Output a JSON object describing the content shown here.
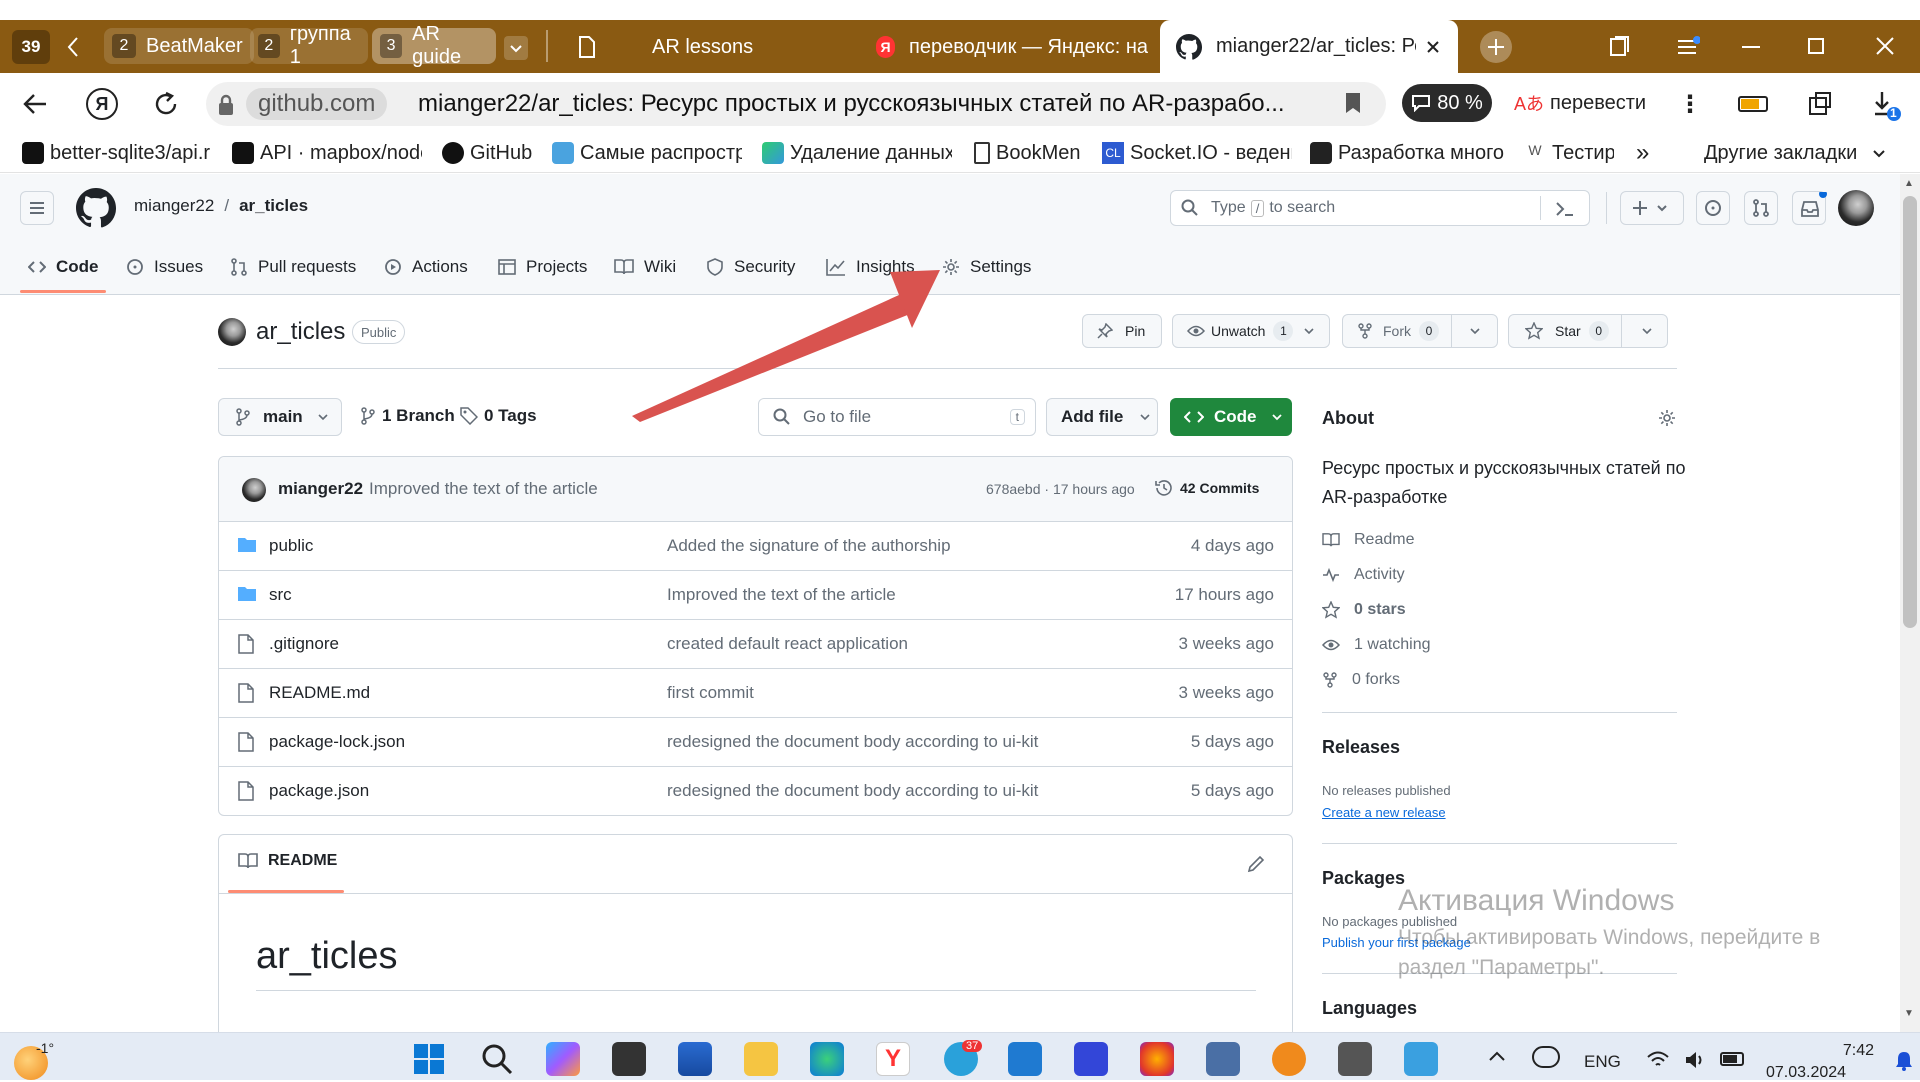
{
  "browser": {
    "tab_count": "39",
    "groups": [
      {
        "num": "2",
        "label": "BeatMaker"
      },
      {
        "num": "2",
        "label": "группа 1"
      },
      {
        "num": "3",
        "label": "AR guide"
      }
    ],
    "tabs": [
      {
        "label": "AR lessons"
      },
      {
        "label": "переводчик — Яндекс: на"
      },
      {
        "label": "mianger22/ar_ticles: Рес"
      }
    ],
    "address": {
      "domain": "github.com",
      "title": "mianger22/ar_ticles: Ресурс простых и русскоязычных статей по AR-разрабо...",
      "zoom": "80 %",
      "translate": "перевести",
      "downloads_badge": "1"
    },
    "bookmarks": [
      "better-sqlite3/api.r",
      "API · mapbox/node",
      "GitHub",
      "Самые распростр",
      "Удаление данных",
      "BookMen",
      "Socket.IO - ведени",
      "Разработка много",
      "Тестир"
    ],
    "bookmarks_more": "»",
    "other_bookmarks": "Другие закладки"
  },
  "github": {
    "breadcrumb": {
      "owner": "mianger22",
      "sep": "/",
      "repo": "ar_ticles"
    },
    "search": {
      "prefix": "Type",
      "key": "/",
      "suffix": "to search"
    },
    "nav": [
      "Code",
      "Issues",
      "Pull requests",
      "Actions",
      "Projects",
      "Wiki",
      "Security",
      "Insights",
      "Settings"
    ],
    "repo_name": "ar_ticles",
    "visibility": "Public",
    "actions": {
      "pin": "Pin",
      "unwatch": "Unwatch",
      "unwatch_count": "1",
      "fork": "Fork",
      "fork_count": "0",
      "star": "Star",
      "star_count": "0"
    },
    "branch": "main",
    "branches": "1 Branch",
    "tags": "0 Tags",
    "goto_file": "Go to file",
    "goto_key": "t",
    "add_file": "Add file",
    "code_button": "Code",
    "commit": {
      "author": "mianger22",
      "message": "Improved the text of the article",
      "hash_time": "678aebd · 17 hours ago",
      "commits": "42 Commits"
    },
    "files": [
      {
        "name": "public",
        "type": "folder",
        "message": "Added the signature of the authorship",
        "time": "4 days ago"
      },
      {
        "name": "src",
        "type": "folder",
        "message": "Improved the text of the article",
        "time": "17 hours ago"
      },
      {
        "name": ".gitignore",
        "type": "file",
        "message": "created default react application",
        "time": "3 weeks ago"
      },
      {
        "name": "README.md",
        "type": "file",
        "message": "first commit",
        "time": "3 weeks ago"
      },
      {
        "name": "package-lock.json",
        "type": "file",
        "message": "redesigned the document body according to ui-kit",
        "time": "5 days ago"
      },
      {
        "name": "package.json",
        "type": "file",
        "message": "redesigned the document body according to ui-kit",
        "time": "5 days ago"
      }
    ],
    "readme": {
      "tab": "README",
      "heading": "ar_ticles"
    },
    "about": {
      "title": "About",
      "description": "Ресурс простых и русскоязычных статей по AR-разработке",
      "items": [
        "Readme",
        "Activity",
        "0 stars",
        "1 watching",
        "0 forks"
      ]
    },
    "releases": {
      "title": "Releases",
      "none": "No releases published",
      "link": "Create a new release"
    },
    "packages": {
      "title": "Packages",
      "none": "No packages published",
      "link": "Publish your first package"
    },
    "languages": {
      "title": "Languages"
    }
  },
  "watermark": {
    "line1": "Активация Windows",
    "line2": "Чтобы активировать Windows, перейдите в",
    "line3": "раздел \"Параметры\"."
  },
  "taskbar": {
    "weather": "-1°",
    "telegram_badge": "37",
    "lang": "ENG",
    "time": "7:42",
    "date": "07.03.2024"
  },
  "colors": {
    "tab_bar": "#8a5a12",
    "code_button": "#1f883d",
    "link": "#0969da",
    "annotation_arrow": "#d9534f"
  }
}
